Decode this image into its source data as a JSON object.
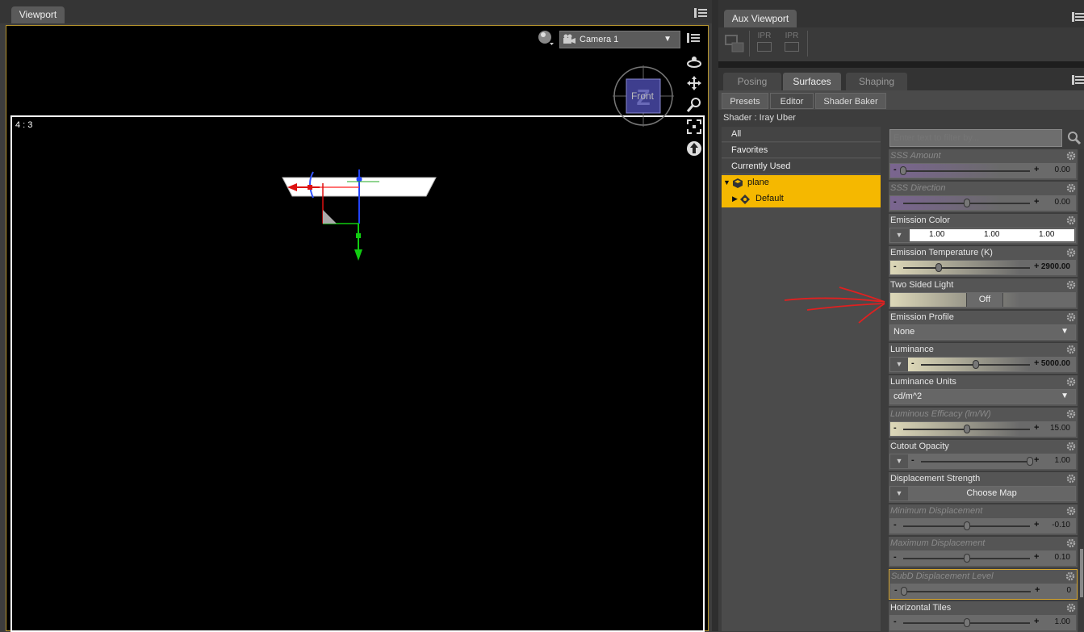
{
  "viewport": {
    "tab": "Viewport",
    "camera": "Camera 1",
    "aspect": "4 : 3",
    "cube_face": "Front"
  },
  "aux": {
    "tab": "Aux Viewport",
    "buttons": [
      "IPR",
      "IPR"
    ]
  },
  "main_tabs": [
    "Posing",
    "Surfaces",
    "Shaping"
  ],
  "sub_tabs": [
    "Presets",
    "Editor",
    "Shader Baker"
  ],
  "shader_label": "Shader : Iray Uber",
  "tree": {
    "items": [
      "All",
      "Favorites",
      "Currently Used"
    ],
    "node": "plane",
    "child": "Default"
  },
  "filter_placeholder": "Enter text to filter by...",
  "props": {
    "sss_amount": {
      "name": "SSS Amount",
      "value": "0.00",
      "level": 0.0
    },
    "sss_direction": {
      "name": "SSS Direction",
      "value": "0.00",
      "level": 0.5
    },
    "emission_color": {
      "name": "Emission Color",
      "r": "1.00",
      "g": "1.00",
      "b": "1.00"
    },
    "emission_temp": {
      "name": "Emission Temperature (K)",
      "value": "2900.00",
      "level": 0.28
    },
    "two_sided": {
      "name": "Two Sided Light",
      "value": "Off"
    },
    "emission_profile": {
      "name": "Emission Profile",
      "value": "None"
    },
    "luminance": {
      "name": "Luminance",
      "value": "5000.00",
      "level": 0.5
    },
    "luminance_units": {
      "name": "Luminance Units",
      "value": "cd/m^2"
    },
    "luminous_efficacy": {
      "name": "Luminous Efficacy (lm/W)",
      "value": "15.00",
      "level": 0.5
    },
    "cutout_opacity": {
      "name": "Cutout Opacity",
      "value": "1.00",
      "level": 1.0
    },
    "displacement_strength": {
      "name": "Displacement Strength",
      "button": "Choose Map"
    },
    "min_displacement": {
      "name": "Minimum Displacement",
      "value": "-0.10",
      "level": 0.5
    },
    "max_displacement": {
      "name": "Maximum Displacement",
      "value": "0.10",
      "level": 0.5
    },
    "subd_level": {
      "name": "SubD Displacement Level",
      "value": "0",
      "level": 0.0
    },
    "horizontal_tiles": {
      "name": "Horizontal Tiles",
      "value": "1.00",
      "level": 0.5
    }
  }
}
